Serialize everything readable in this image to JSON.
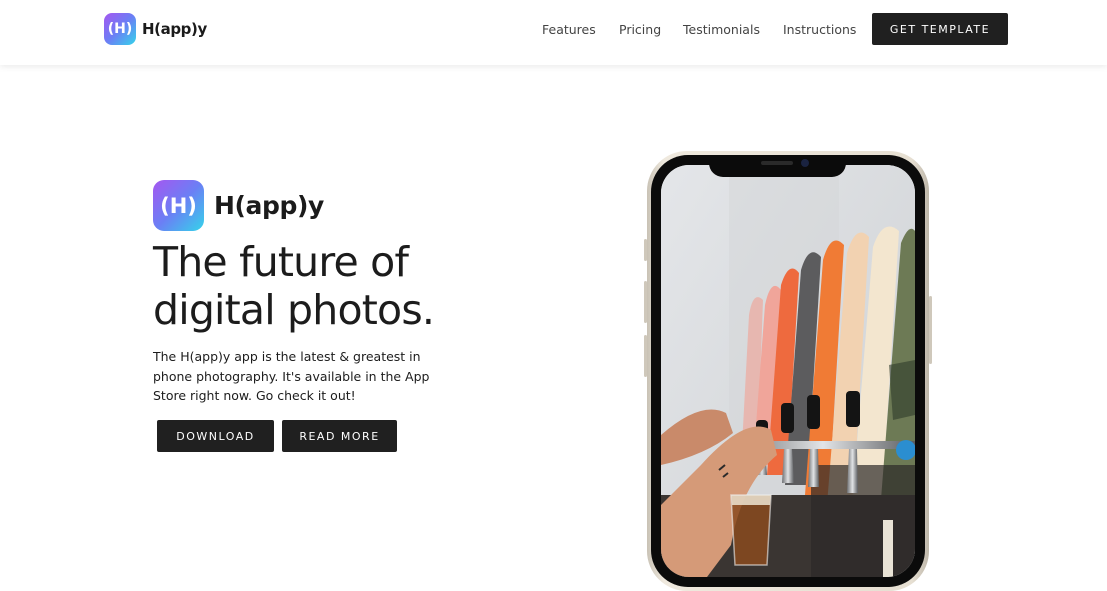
{
  "brand": {
    "logo_mark": "(H)",
    "name": "H(app)y"
  },
  "nav": {
    "features": "Features",
    "pricing": "Pricing",
    "testimonials": "Testimonials",
    "instructions": "Instructions",
    "cta": "GET TEMPLATE"
  },
  "hero": {
    "logo_mark": "(H)",
    "logo_name": "H(app)y",
    "title_line1": "The future of",
    "title_line2": "digital photos.",
    "description": "The H(app)y app is the latest & greatest in phone photography. It's available in the App Store right now. Go check it out!",
    "download_label": "DOWNLOAD",
    "read_more_label": "READ MORE"
  },
  "colors": {
    "logo_gradient_start": "#a557f0",
    "logo_gradient_end": "#34d4ea",
    "button_dark": "#202020",
    "text_dark": "#1c1c1c"
  },
  "icons": {
    "logo": "happy-logo-icon",
    "phone": "phone-mockup"
  }
}
